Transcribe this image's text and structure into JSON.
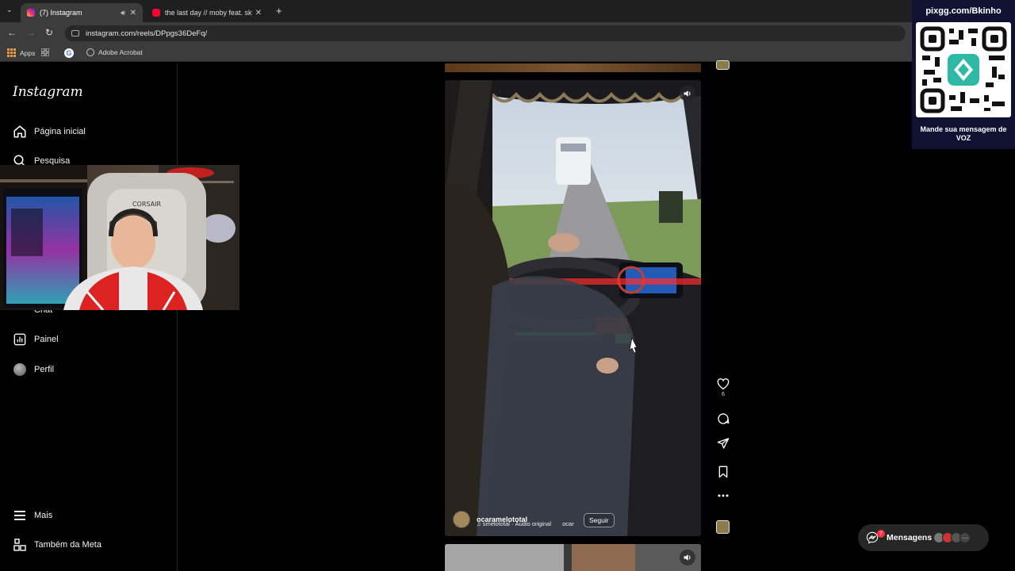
{
  "browser": {
    "tabs": [
      {
        "title": "(7) Instagram",
        "active": true
      },
      {
        "title": "the last day // moby feat. skylar",
        "active": false
      }
    ],
    "url": "instagram.com/reels/DPpgs36DeFq/",
    "bookmarks": [
      "Apps",
      "Adobe Acrobat"
    ]
  },
  "sidebar": {
    "logo": "Instagram",
    "items": [
      {
        "label": "Página inicial",
        "icon": "home-icon"
      },
      {
        "label": "Pesquisa",
        "icon": "search-icon"
      },
      {
        "label": "Chat",
        "icon": "chat-icon"
      },
      {
        "label": "Painel",
        "icon": "dashboard-icon"
      },
      {
        "label": "Perfil",
        "icon": "profile-avatar"
      }
    ],
    "bottom": [
      {
        "label": "Mais",
        "icon": "menu-icon"
      },
      {
        "label": "Também da Meta",
        "icon": "meta-icon"
      }
    ]
  },
  "reel": {
    "author": "ocaramelototal",
    "audio": "smelototal · Áudio original",
    "audio_extra": "ocar",
    "follow_label": "Seguir",
    "likes": "6"
  },
  "overlay": {
    "qr_title": "pixgg.com/Bkinho",
    "qr_caption": "Mande sua mensagem de VOZ"
  },
  "messages": {
    "label": "Mensagens",
    "badge": "7"
  },
  "colors": {
    "background": "#000000",
    "sidebar_border": "#262626",
    "badge": "#ff3040",
    "qr_panel": "#0f1232"
  }
}
